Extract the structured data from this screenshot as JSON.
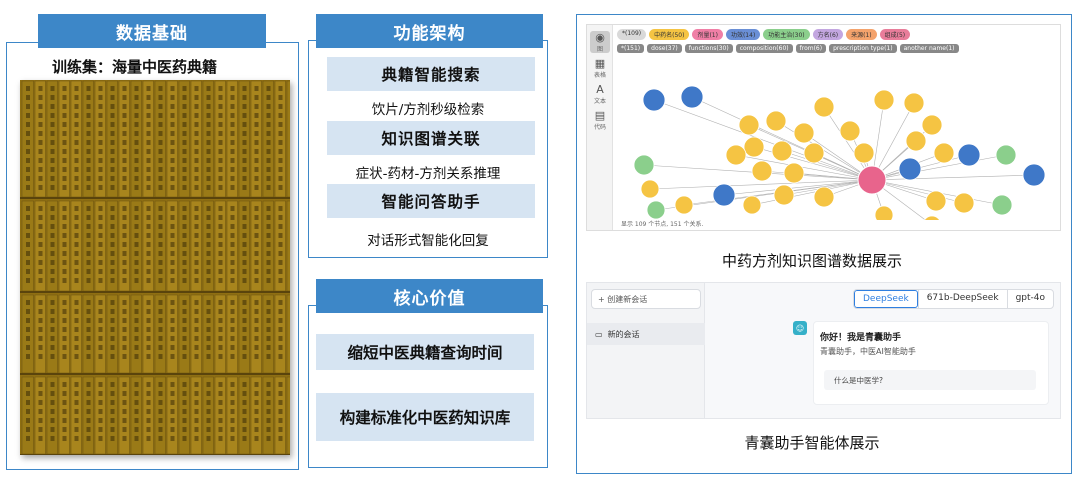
{
  "column1": {
    "header": "数据基础",
    "subtitle": "训练集：海量中医药典籍"
  },
  "column2": {
    "header": "功能架构",
    "features": [
      {
        "label": "典籍智能搜索",
        "desc": "饮片/方剂秒级检索"
      },
      {
        "label": "知识图谱关联",
        "desc": "症状-药材-方剂关系推理"
      },
      {
        "label": "智能问答助手",
        "desc": "对话形式智能化回复"
      }
    ],
    "value_header": "核心价值",
    "values": [
      "缩短中医典籍查询时间",
      "构建标准化中医药知识库"
    ]
  },
  "column3": {
    "graph_caption": "中药方剂知识图谱数据展示",
    "chat_caption": "青囊助手智能体展示",
    "graph": {
      "side_icons": [
        {
          "icon": "graph-icon",
          "label": "图"
        },
        {
          "icon": "table-icon",
          "label": "表格"
        },
        {
          "icon": "text-icon",
          "label": "文本"
        },
        {
          "icon": "code-icon",
          "label": "代码"
        }
      ],
      "label_pills": [
        {
          "text": "*(109)",
          "color": "#d9d9d9"
        },
        {
          "text": "中药名(50)",
          "color": "#f5c443"
        },
        {
          "text": "剂量(1)",
          "color": "#f07fa6"
        },
        {
          "text": "功效(14)",
          "color": "#6a8fd6"
        },
        {
          "text": "功能主治(30)",
          "color": "#8bcf8c"
        },
        {
          "text": "方名(6)",
          "color": "#c3a6e0"
        },
        {
          "text": "来源(1)",
          "color": "#f4a36c"
        },
        {
          "text": "组成(5)",
          "color": "#e87d9a"
        }
      ],
      "rel_pills": [
        "*(151)",
        "dose(37)",
        "functions(30)",
        "composition(60)",
        "from(6)",
        "prescription type(1)",
        "another name(1)"
      ],
      "status": "显示 109 个节点, 151 个关系."
    },
    "chat": {
      "new_chat": "+ 创建新会话",
      "conversation": "新的会话",
      "models": [
        "DeepSeek",
        "671b-DeepSeek",
        "gpt-4o"
      ],
      "greeting": "你好！我是青囊助手",
      "greeting_sub": "青囊助手，中医AI智能助手",
      "sample_question": "什么是中医学?"
    }
  }
}
